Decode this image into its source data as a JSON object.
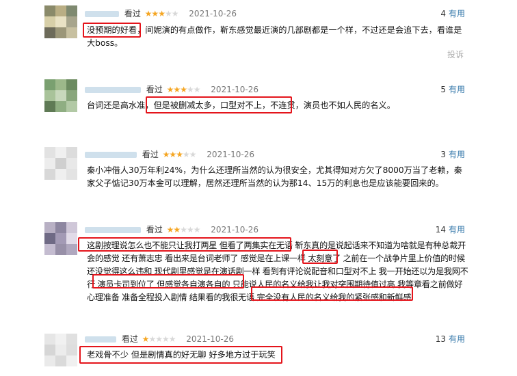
{
  "reviews": [
    {
      "watched": "看过",
      "stars": 3,
      "date": "2021-10-26",
      "useful_count": "4",
      "useful_label": "有用",
      "text": "没预期的好看，间妮演的有点做作，靳东感觉最近演的几部剧都是一个样，不过还是会追下去，看谁是大boss。",
      "report": "投诉"
    },
    {
      "watched": "看过",
      "stars": 3,
      "date": "2021-10-26",
      "useful_count": "5",
      "useful_label": "有用",
      "text": "台词还是高水准，但是被删减太多，口型对不上，不连贯，演员也不如人民的名义。"
    },
    {
      "watched": "看过",
      "stars": 3,
      "date": "2021-10-26",
      "useful_count": "3",
      "useful_label": "有用",
      "text": "秦小冲借人30万年利24%，为什么还理所当然的认为很安全，尤其得知对方欠了8000万当了老赖，秦家父子惦记30万本金可以理解，居然还理所当然的认为那14、15万的利息也是应该能要回来的。"
    },
    {
      "watched": "看过",
      "stars": 2,
      "date": "2021-10-26",
      "useful_count": "14",
      "useful_label": "有用",
      "text": "这剧按理说怎么也不能只让我打两星 但看了两集实在无语 靳东真的是说起话来不知道为啥就是有种总裁开会的感觉 还有萧志忠 看出来是台词老师了 感觉是在上课一样 太刻意了 之前在一个战争片里上价值的时候还没觉得这么违和 现代剧里感觉是在演话剧一样 看到有评论说配音和口型对不上 我一开始还以为是我网不行 演员卡司到位了 但感觉各自演各自的 只能说人民的名义给我让我对突围期待值过高 我等章看之前做好心理准备 准备全程投入剧情 结果看的我很无语 完全没有人民的名义给我的紧张感和新鲜感"
    },
    {
      "watched": "看过",
      "stars": 1,
      "date": "2021-10-26",
      "useful_count": "13",
      "useful_label": "有用",
      "text": "老戏骨不少 但是剧情真的好无聊 好多地方过于玩笑"
    }
  ]
}
